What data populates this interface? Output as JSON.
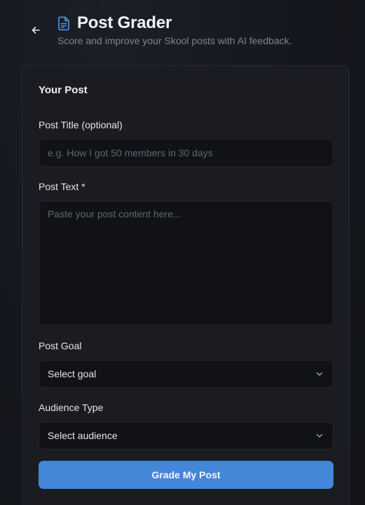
{
  "header": {
    "title": "Post Grader",
    "subtitle": "Score and improve your Skool posts with AI feedback.",
    "back_icon": "arrow-left-icon",
    "title_icon": "document-icon"
  },
  "form": {
    "card_title": "Your Post",
    "post_title": {
      "label": "Post Title (optional)",
      "placeholder": "e.g. How I got 50 members in 30 days",
      "value": ""
    },
    "post_text": {
      "label": "Post Text *",
      "placeholder": "Paste your post content here...",
      "value": ""
    },
    "post_goal": {
      "label": "Post Goal",
      "selected": "Select goal"
    },
    "audience_type": {
      "label": "Audience Type",
      "selected": "Select audience"
    },
    "submit_label": "Grade My Post"
  },
  "colors": {
    "accent": "#4486d8",
    "background": "#15181e",
    "card": "#1a1c21",
    "input": "#101216"
  }
}
